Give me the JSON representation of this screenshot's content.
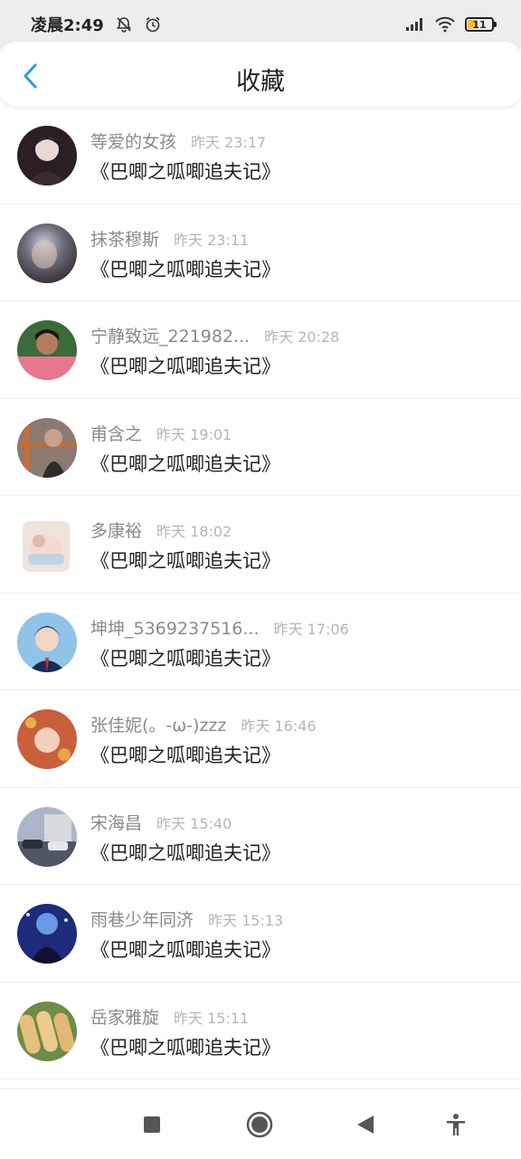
{
  "status": {
    "time": "凌晨2:49",
    "battery": "11",
    "icons": [
      "mute-bell-icon",
      "alarm-icon",
      "signal-icon",
      "wifi-icon",
      "battery-icon"
    ]
  },
  "header": {
    "title": "收藏",
    "back_icon": "chevron-left-icon",
    "accent": "#2f9ae0"
  },
  "items": [
    {
      "name": "等爱的女孩",
      "time": "昨天 23:17",
      "book": "《巴唧之呱唧追夫记》",
      "avatar_color": "#2b1f24"
    },
    {
      "name": "抹茶穆斯",
      "time": "昨天 23:11",
      "book": "《巴唧之呱唧追夫记》",
      "avatar_color": "#5a5a63"
    },
    {
      "name": "宁静致远_221982...",
      "time": "昨天 20:28",
      "book": "《巴唧之呱唧追夫记》",
      "avatar_color": "#e7768f"
    },
    {
      "name": "甫含之",
      "time": "昨天 19:01",
      "book": "《巴唧之呱唧追夫记》",
      "avatar_color": "#7a5a46"
    },
    {
      "name": "多康裕",
      "time": "昨天 18:02",
      "book": "《巴唧之呱唧追夫记》",
      "avatar_color": "#e8d6cd"
    },
    {
      "name": "坤坤_5369237516...",
      "time": "昨天 17:06",
      "book": "《巴唧之呱唧追夫记》",
      "avatar_color": "#8fc3e8"
    },
    {
      "name": "张佳妮(。-ω-)zzz",
      "time": "昨天 16:46",
      "book": "《巴唧之呱唧追夫记》",
      "avatar_color": "#c8603c"
    },
    {
      "name": "宋海昌",
      "time": "昨天 15:40",
      "book": "《巴唧之呱唧追夫记》",
      "avatar_color": "#7d8aa1"
    },
    {
      "name": "雨巷少年同济",
      "time": "昨天 15:13",
      "book": "《巴唧之呱唧追夫记》",
      "avatar_color": "#1e2a7a"
    },
    {
      "name": "岳家雅旋",
      "time": "昨天 15:11",
      "book": "《巴唧之呱唧追夫记》",
      "avatar_color": "#d9b06b"
    }
  ],
  "nav": {
    "icons": [
      "recents-square-icon",
      "home-circle-icon",
      "back-triangle-icon",
      "accessibility-icon"
    ]
  }
}
